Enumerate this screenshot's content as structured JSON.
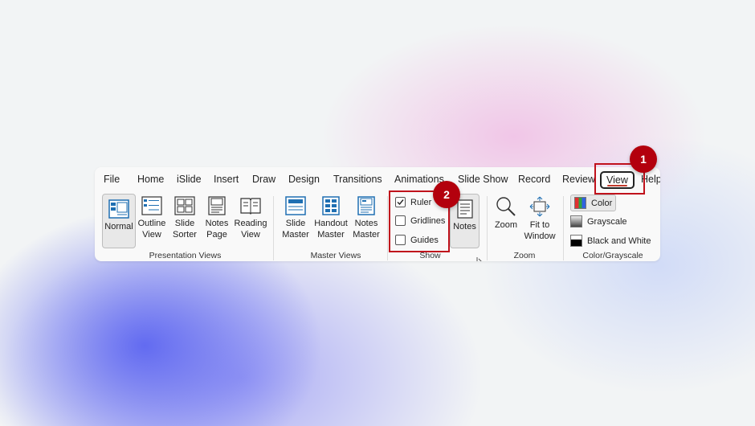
{
  "tabs": [
    "File",
    "Home",
    "iSlide",
    "Insert",
    "Draw",
    "Design",
    "Transitions",
    "Animations",
    "Slide Show",
    "Record",
    "Review",
    "View",
    "Help"
  ],
  "presentation_views": {
    "normal": "Normal",
    "outline": [
      "Outline",
      "View"
    ],
    "slide_sorter": [
      "Slide",
      "Sorter"
    ],
    "notes_page": [
      "Notes",
      "Page"
    ],
    "reading_view": [
      "Reading",
      "View"
    ],
    "group_label": "Presentation Views"
  },
  "master_views": {
    "slide_master": [
      "Slide",
      "Master"
    ],
    "handout_master": [
      "Handout",
      "Master"
    ],
    "notes_master": [
      "Notes",
      "Master"
    ],
    "group_label": "Master Views"
  },
  "show": {
    "ruler": "Ruler",
    "ruler_checked": true,
    "gridlines": "Gridlines",
    "gridlines_checked": false,
    "guides": "Guides",
    "guides_checked": false,
    "notes": "Notes",
    "group_label": "Show"
  },
  "zoom": {
    "zoom": "Zoom",
    "fit": [
      "Fit to",
      "Window"
    ],
    "group_label": "Zoom"
  },
  "color_grayscale": {
    "color": "Color",
    "grayscale": "Grayscale",
    "black_white": "Black and White",
    "group_label": "Color/Grayscale"
  },
  "callouts": [
    "1",
    "2"
  ],
  "colors": {
    "callout": "#b3000d",
    "highlight": "#c0121c",
    "accent_underline": "#c0392b"
  }
}
